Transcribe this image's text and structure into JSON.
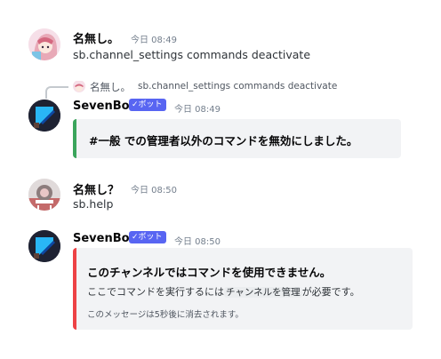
{
  "messages": [
    {
      "username": "名無し。",
      "timestamp": "今日 08:49",
      "content": "sb.channel_settings commands deactivate"
    },
    {
      "reply": {
        "username": "名無し。",
        "content": "sb.channel_settings commands deactivate"
      },
      "username": "SevenBot",
      "bot_tag": "✓ボット",
      "timestamp": "今日 08:49",
      "embed": {
        "color": "#3ba55c",
        "title": "#一般 での管理者以外のコマンドを無効にしました。"
      }
    },
    {
      "username": "名無し？",
      "timestamp": "今日 08:50",
      "content": "sb.help"
    },
    {
      "username": "SevenBot",
      "bot_tag": "✓ボット",
      "timestamp": "今日 08:50",
      "embed": {
        "color": "#ed4245",
        "title": "このチャンネルではコマンドを使用できません。",
        "description_pre": "ここでコマンドを実行するには",
        "description_code": "チャンネルを管理",
        "description_post": "が必要です。",
        "footer": "このメッセージは5秒後に消去されます。"
      }
    }
  ]
}
